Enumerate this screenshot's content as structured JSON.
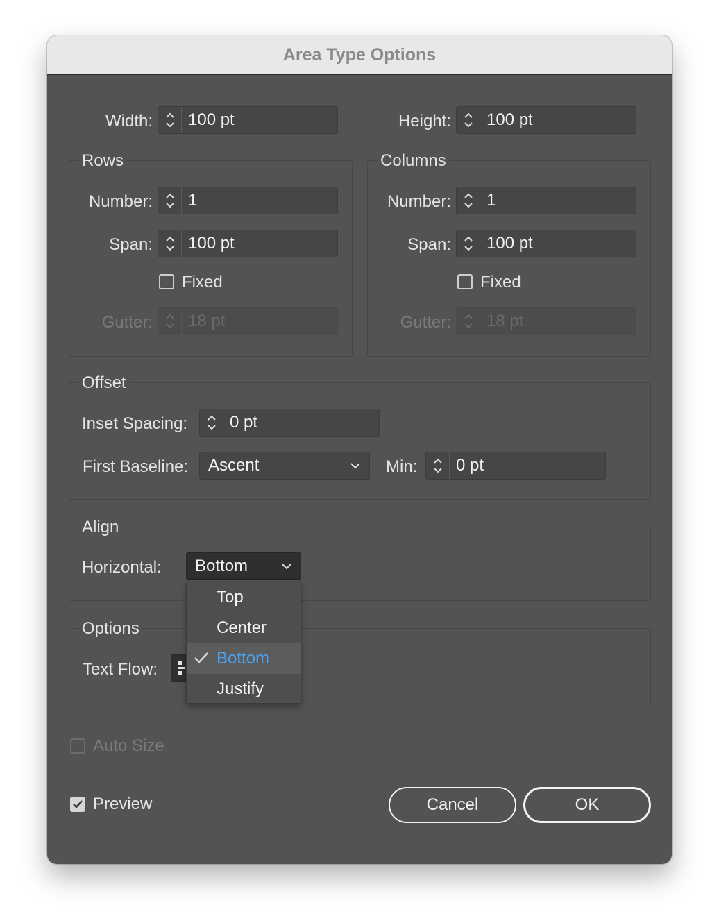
{
  "window": {
    "title": "Area Type Options"
  },
  "size": {
    "width_label": "Width:",
    "width_value": "100 pt",
    "height_label": "Height:",
    "height_value": "100 pt"
  },
  "rows": {
    "title": "Rows",
    "number_label": "Number:",
    "number_value": "1",
    "span_label": "Span:",
    "span_value": "100 pt",
    "fixed_label": "Fixed",
    "fixed_checked": false,
    "gutter_label": "Gutter:",
    "gutter_value": "18 pt"
  },
  "columns": {
    "title": "Columns",
    "number_label": "Number:",
    "number_value": "1",
    "span_label": "Span:",
    "span_value": "100 pt",
    "fixed_label": "Fixed",
    "fixed_checked": false,
    "gutter_label": "Gutter:",
    "gutter_value": "18 pt"
  },
  "offset": {
    "title": "Offset",
    "inset_label": "Inset Spacing:",
    "inset_value": "0 pt",
    "first_baseline_label": "First Baseline:",
    "first_baseline_value": "Ascent",
    "min_label": "Min:",
    "min_value": "0 pt"
  },
  "align": {
    "title": "Align",
    "horizontal_label": "Horizontal:",
    "horizontal_value": "Bottom",
    "menu_items": [
      {
        "label": "Top",
        "selected": false
      },
      {
        "label": "Center",
        "selected": false
      },
      {
        "label": "Bottom",
        "selected": true
      },
      {
        "label": "Justify",
        "selected": false
      }
    ],
    "selected_color": "#4aa3f0"
  },
  "options": {
    "title": "Options",
    "text_flow_label": "Text Flow:"
  },
  "auto_size": {
    "label": "Auto Size",
    "checked": false,
    "disabled": true
  },
  "preview": {
    "label": "Preview",
    "checked": true
  },
  "buttons": {
    "cancel": "Cancel",
    "ok": "OK"
  }
}
